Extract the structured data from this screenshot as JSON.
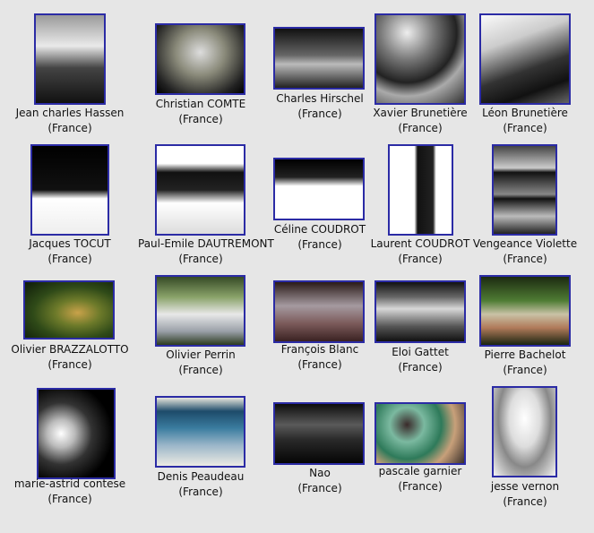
{
  "gallery": {
    "country": "(France)",
    "items": [
      {
        "name": "Jean charles Hassen"
      },
      {
        "name": "Christian COMTE"
      },
      {
        "name": "Charles Hirschel"
      },
      {
        "name": "Xavier Brunetière"
      },
      {
        "name": "Léon Brunetière"
      },
      {
        "name": "Jacques TOCUT"
      },
      {
        "name": "Paul-Emile DAUTREMONT"
      },
      {
        "name": "Céline COUDROT"
      },
      {
        "name": "Laurent COUDROT"
      },
      {
        "name": "Vengeance Violette"
      },
      {
        "name": "Olivier BRAZZALOTTO"
      },
      {
        "name": "Olivier Perrin"
      },
      {
        "name": "François Blanc"
      },
      {
        "name": "Eloi Gattet"
      },
      {
        "name": "Pierre Bachelot"
      },
      {
        "name": "marie-astrid contese"
      },
      {
        "name": "Denis Peaudeau"
      },
      {
        "name": "Nao"
      },
      {
        "name": "pascale garnier"
      },
      {
        "name": "jesse vernon"
      }
    ]
  }
}
